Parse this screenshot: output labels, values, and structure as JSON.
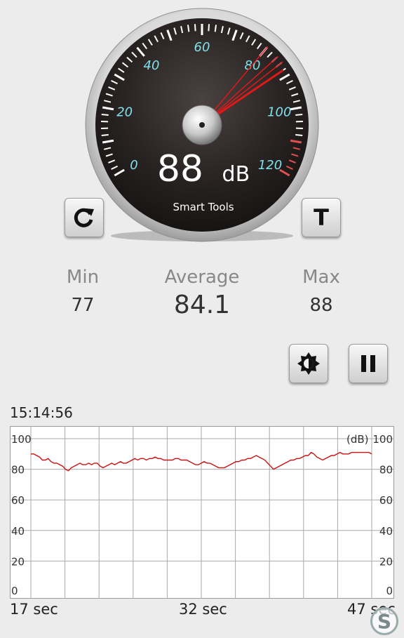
{
  "gauge": {
    "reading": "88",
    "unit": "dB",
    "brand": "Smart Tools",
    "scale_labels": [
      "0",
      "20",
      "40",
      "60",
      "80",
      "100",
      "120"
    ],
    "scale_min": 0,
    "scale_max": 120,
    "needle_value": 88,
    "trail_values": [
      80,
      84,
      86
    ],
    "accent_color": "#7fe0ea",
    "needle_color": "#e01818"
  },
  "buttons": {
    "reset_icon": "refresh-icon",
    "t_label": "T",
    "brightness_icon": "brightness-icon",
    "pause_icon": "pause-icon"
  },
  "stats": {
    "min_label": "Min",
    "min_value": "77",
    "avg_label": "Average",
    "avg_value": "84.1",
    "max_label": "Max",
    "max_value": "88"
  },
  "graph": {
    "time": "15:14:56",
    "unit_label": "(dB)",
    "y_ticks_left": [
      "100",
      "80",
      "60",
      "40",
      "20",
      "0"
    ],
    "y_ticks_right": [
      "100",
      "80",
      "60",
      "40",
      "20",
      "0"
    ],
    "x_labels": [
      "17 sec",
      "32 sec",
      "47 sec"
    ],
    "line_color": "#cc1111",
    "series_db": [
      90,
      90,
      89,
      88,
      86,
      86,
      87,
      85,
      84,
      84,
      83,
      82,
      80,
      79,
      81,
      82,
      83,
      84,
      83,
      83,
      84,
      83,
      84,
      84,
      82,
      81,
      82,
      83,
      84,
      83,
      84,
      85,
      84,
      84,
      85,
      86,
      87,
      86,
      87,
      87,
      86,
      87,
      87,
      88,
      87,
      87,
      86,
      86,
      86,
      86,
      87,
      87,
      86,
      86,
      86,
      85,
      84,
      83,
      83,
      84,
      85,
      84,
      84,
      83,
      82,
      81,
      81,
      81,
      82,
      83,
      84,
      85,
      85,
      86,
      86,
      87,
      87,
      88,
      89,
      88,
      87,
      86,
      84,
      82,
      80,
      81,
      82,
      83,
      84,
      85,
      86,
      86,
      87,
      87,
      88,
      89,
      89,
      91,
      90,
      88,
      87,
      86,
      87,
      88,
      89,
      89,
      90,
      91,
      90,
      90,
      90,
      91,
      91,
      91,
      91,
      91,
      91,
      91,
      90
    ]
  },
  "watermark": {
    "glyph": "S"
  }
}
